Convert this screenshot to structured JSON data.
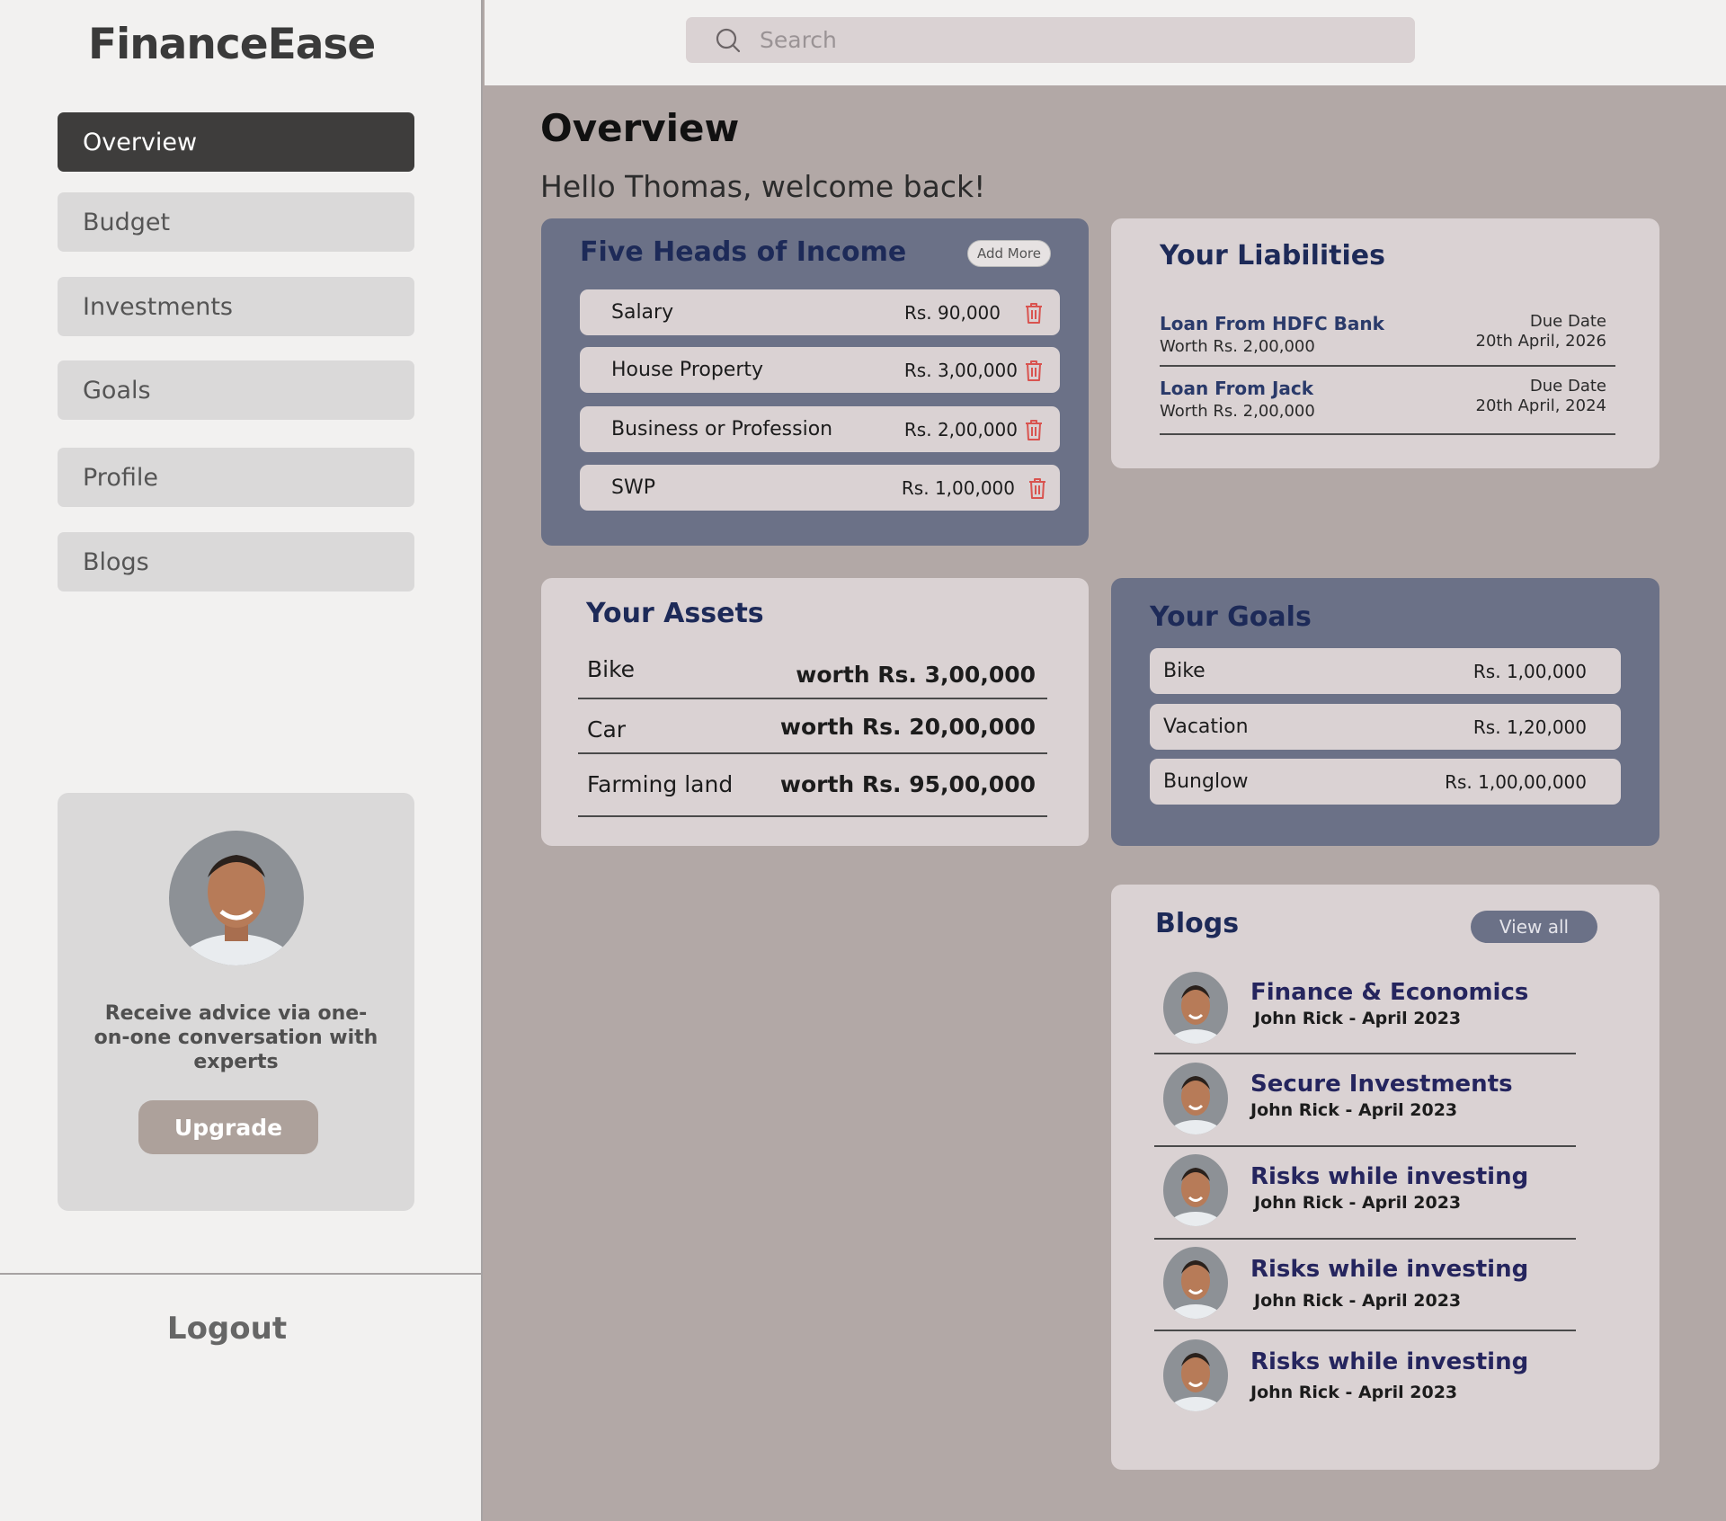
{
  "app": {
    "name": "FinanceEase"
  },
  "nav": {
    "items": [
      {
        "label": "Overview",
        "active": true
      },
      {
        "label": "Budget"
      },
      {
        "label": "Investments"
      },
      {
        "label": "Goals"
      },
      {
        "label": "Profile"
      },
      {
        "label": "Blogs"
      }
    ],
    "logout": "Logout"
  },
  "upgrade": {
    "text": "Receive advice via one-on-one conversation with experts",
    "button": "Upgrade"
  },
  "search": {
    "placeholder": "Search"
  },
  "main": {
    "title": "Overview",
    "welcome": "Hello Thomas, welcome back!"
  },
  "income": {
    "title": "Five Heads of Income",
    "add_more": "Add More",
    "items": [
      {
        "label": "Salary",
        "amount": "Rs. 90,000"
      },
      {
        "label": "House Property",
        "amount": "Rs. 3,00,000"
      },
      {
        "label": "Business or Profession",
        "amount": "Rs. 2,00,000"
      },
      {
        "label": "SWP",
        "amount": "Rs. 1,00,000"
      }
    ]
  },
  "liabilities": {
    "title": "Your Liabilities",
    "items": [
      {
        "name": "Loan From HDFC Bank",
        "worth": "Worth Rs. 2,00,000",
        "due_label": "Due Date",
        "due_date": "20th April, 2026"
      },
      {
        "name": "Loan From Jack",
        "worth": "Worth Rs. 2,00,000",
        "due_label": "Due Date",
        "due_date": "20th April, 2024"
      }
    ]
  },
  "assets": {
    "title": "Your Assets",
    "items": [
      {
        "name": "Bike",
        "worth": "worth Rs. 3,00,000"
      },
      {
        "name": "Car",
        "worth": "worth Rs. 20,00,000"
      },
      {
        "name": "Farming land",
        "worth": "worth Rs. 95,00,000"
      }
    ]
  },
  "goals": {
    "title": "Your Goals",
    "items": [
      {
        "label": "Bike",
        "amount": "Rs. 1,00,000"
      },
      {
        "label": "Vacation",
        "amount": "Rs. 1,20,000"
      },
      {
        "label": "Bunglow",
        "amount": "Rs. 1,00,00,000"
      }
    ]
  },
  "blogs": {
    "title": "Blogs",
    "view_all": "View all",
    "items": [
      {
        "title": "Finance & Economics",
        "meta": "John Rick - April 2023"
      },
      {
        "title": "Secure Investments",
        "meta": "John Rick - April 2023"
      },
      {
        "title": "Risks while investing",
        "meta": "John Rick - April 2023"
      },
      {
        "title": "Risks while investing",
        "meta": "John Rick - April 2023"
      },
      {
        "title": "Risks while investing",
        "meta": "John Rick - April 2023"
      }
    ]
  },
  "colors": {
    "sidebar_bg": "#f2f1f0",
    "main_bg": "#b2a8a6",
    "dark_card": "#6b7187",
    "light_card": "#dad2d3",
    "active_nav": "#3e3d3c",
    "title_navy": "#1d2a58",
    "trash_red": "#d9534f"
  }
}
